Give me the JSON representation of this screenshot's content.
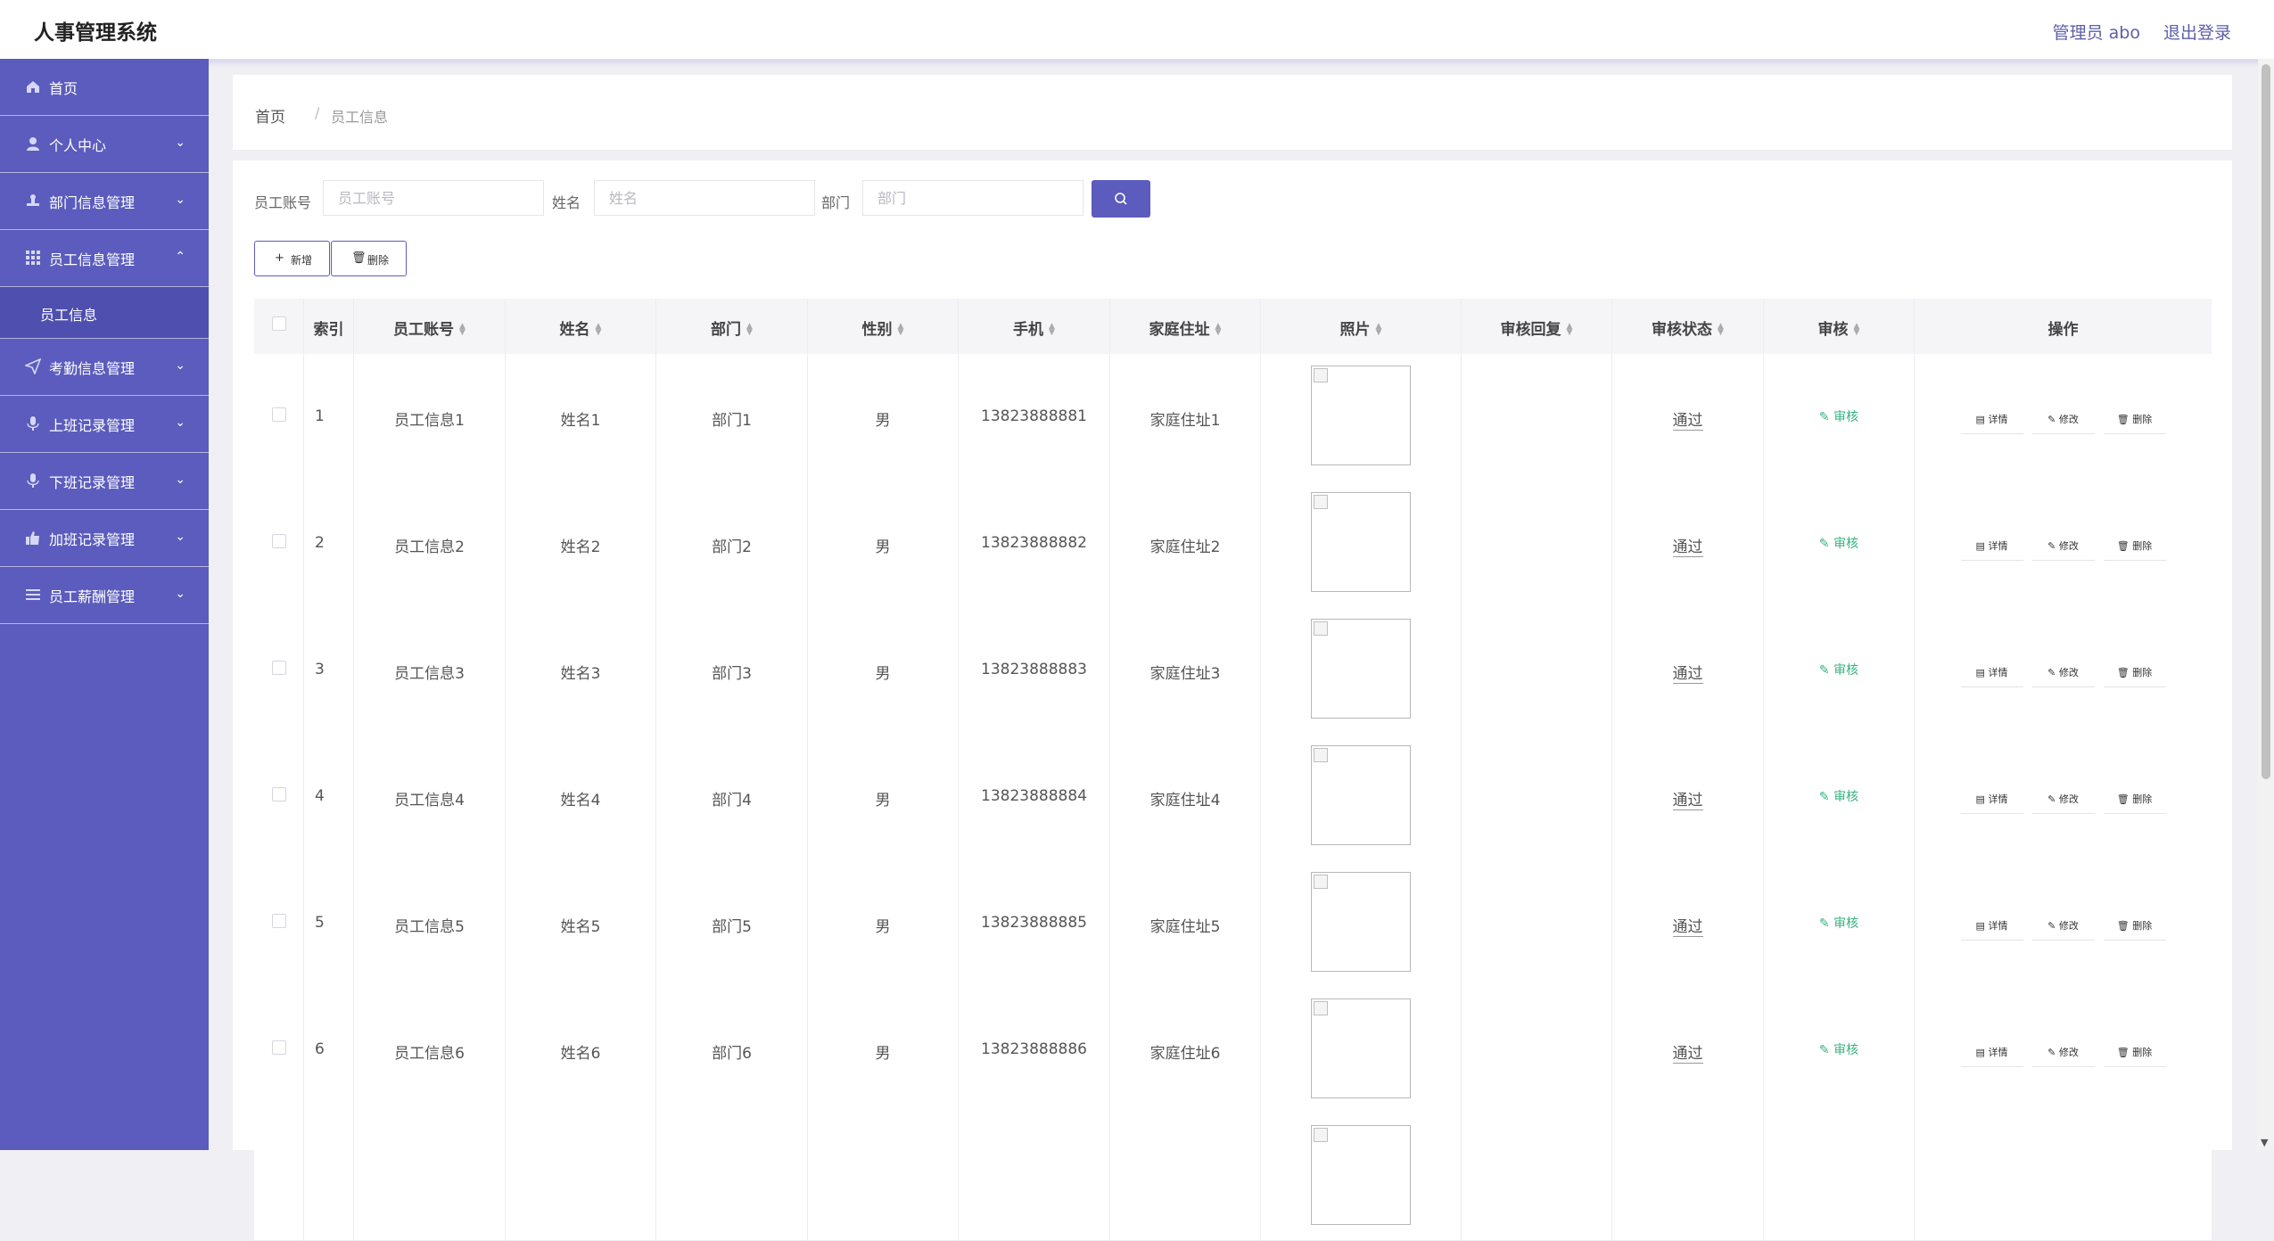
{
  "header": {
    "title": "人事管理系统",
    "admin": "管理员 abo",
    "logout": "退出登录"
  },
  "sidebar": {
    "items": [
      {
        "label": "首页",
        "icon": "home-icon",
        "chevron": ""
      },
      {
        "label": "个人中心",
        "icon": "user-icon",
        "chevron": "⌄"
      },
      {
        "label": "部门信息管理",
        "icon": "stamp-icon",
        "chevron": "⌄"
      },
      {
        "label": "员工信息管理",
        "icon": "grid-icon",
        "chevron": "⌃"
      },
      {
        "label": "员工信息",
        "sub": true
      },
      {
        "label": "考勤信息管理",
        "icon": "send-icon",
        "chevron": "⌄"
      },
      {
        "label": "上班记录管理",
        "icon": "mic-icon",
        "chevron": "⌄"
      },
      {
        "label": "下班记录管理",
        "icon": "mic-icon",
        "chevron": "⌄"
      },
      {
        "label": "加班记录管理",
        "icon": "thumb-icon",
        "chevron": "⌄"
      },
      {
        "label": "员工薪酬管理",
        "icon": "list-icon",
        "chevron": "⌄"
      }
    ]
  },
  "breadcrumb": {
    "home": "首页",
    "separator": "/",
    "current": "员工信息"
  },
  "search": {
    "account_label": "员工账号",
    "account_placeholder": "员工账号",
    "name_label": "姓名",
    "name_placeholder": "姓名",
    "dept_label": "部门",
    "dept_placeholder": "部门"
  },
  "actions": {
    "add": "新增",
    "delete": "删除"
  },
  "table": {
    "columns": [
      "索引",
      "员工账号",
      "姓名",
      "部门",
      "性别",
      "手机",
      "家庭住址",
      "照片",
      "审核回复",
      "审核状态",
      "审核",
      "操作"
    ],
    "rows": [
      {
        "index": "1",
        "account": "员工信息1",
        "name": "姓名1",
        "dept": "部门1",
        "gender": "男",
        "phone": "13823888881",
        "address": "家庭住址1",
        "reply": "",
        "status": "通过"
      },
      {
        "index": "2",
        "account": "员工信息2",
        "name": "姓名2",
        "dept": "部门2",
        "gender": "男",
        "phone": "13823888882",
        "address": "家庭住址2",
        "reply": "",
        "status": "通过"
      },
      {
        "index": "3",
        "account": "员工信息3",
        "name": "姓名3",
        "dept": "部门3",
        "gender": "男",
        "phone": "13823888883",
        "address": "家庭住址3",
        "reply": "",
        "status": "通过"
      },
      {
        "index": "4",
        "account": "员工信息4",
        "name": "姓名4",
        "dept": "部门4",
        "gender": "男",
        "phone": "13823888884",
        "address": "家庭住址4",
        "reply": "",
        "status": "通过"
      },
      {
        "index": "5",
        "account": "员工信息5",
        "name": "姓名5",
        "dept": "部门5",
        "gender": "男",
        "phone": "13823888885",
        "address": "家庭住址5",
        "reply": "",
        "status": "通过"
      },
      {
        "index": "6",
        "account": "员工信息6",
        "name": "姓名6",
        "dept": "部门6",
        "gender": "男",
        "phone": "13823888886",
        "address": "家庭住址6",
        "reply": "",
        "status": "通过"
      },
      {
        "index": "",
        "account": "",
        "name": "",
        "dept": "",
        "gender": "",
        "phone": "",
        "address": "",
        "reply": "",
        "status": ""
      }
    ],
    "audit_label": "审核",
    "detail_label": "详情",
    "edit_label": "修改",
    "delete_label": "删除"
  },
  "colors": {
    "accent": "#5b5cbd",
    "audit_green": "#36b37e"
  }
}
